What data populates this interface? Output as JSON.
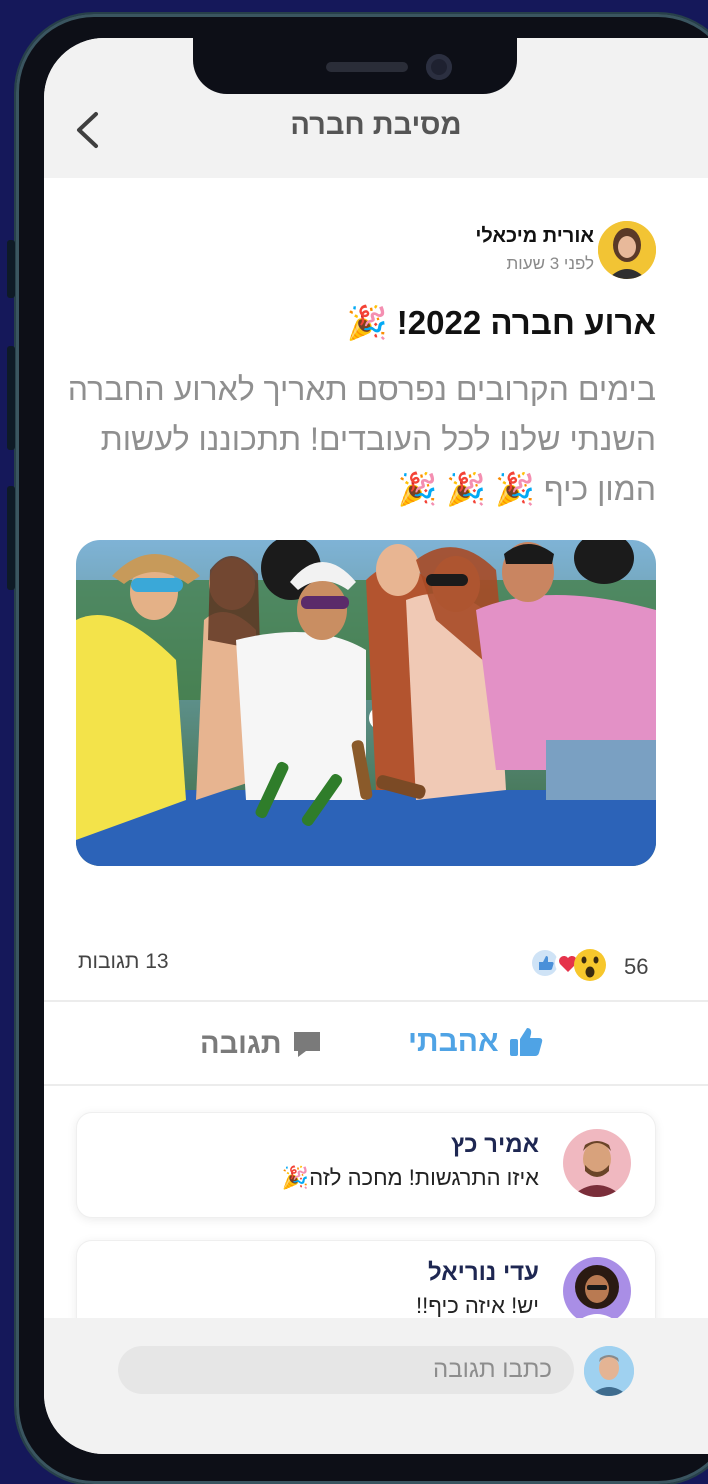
{
  "header": {
    "title": "מסיבת חברה",
    "back_icon": "chevron-left-icon"
  },
  "post": {
    "author_name": "אורית מיכאלי",
    "time": "לפני 3 שעות",
    "title": "ארוע חברה 2022! 🎉",
    "body": "בימים הקרובים נפרסם תאריך לארוע החברה השנתי שלנו לכל העובדים! תתכוננו לעשות המון כיף 🎉 🎉 🎉",
    "image_alt": "party-photo",
    "reactions_count": "56",
    "reaction_icons": [
      "thumbs-up-icon",
      "heart-icon",
      "wow-icon"
    ],
    "comments_count": "13 תגובות"
  },
  "actions": {
    "like_label": "אהבתי",
    "like_color": "#4fa3e5",
    "reply_label": "תגובה"
  },
  "comments": [
    {
      "name": "אמיר כץ",
      "text": "איזו התרגשות! מחכה לזה🎉"
    },
    {
      "name": "עדי נוריאל",
      "text": "יש! איזה כיף!!"
    }
  ],
  "reply_box": {
    "placeholder": "כתבו תגובה"
  },
  "colors": {
    "background": "#15185a",
    "accent": "#4fa3e5"
  }
}
